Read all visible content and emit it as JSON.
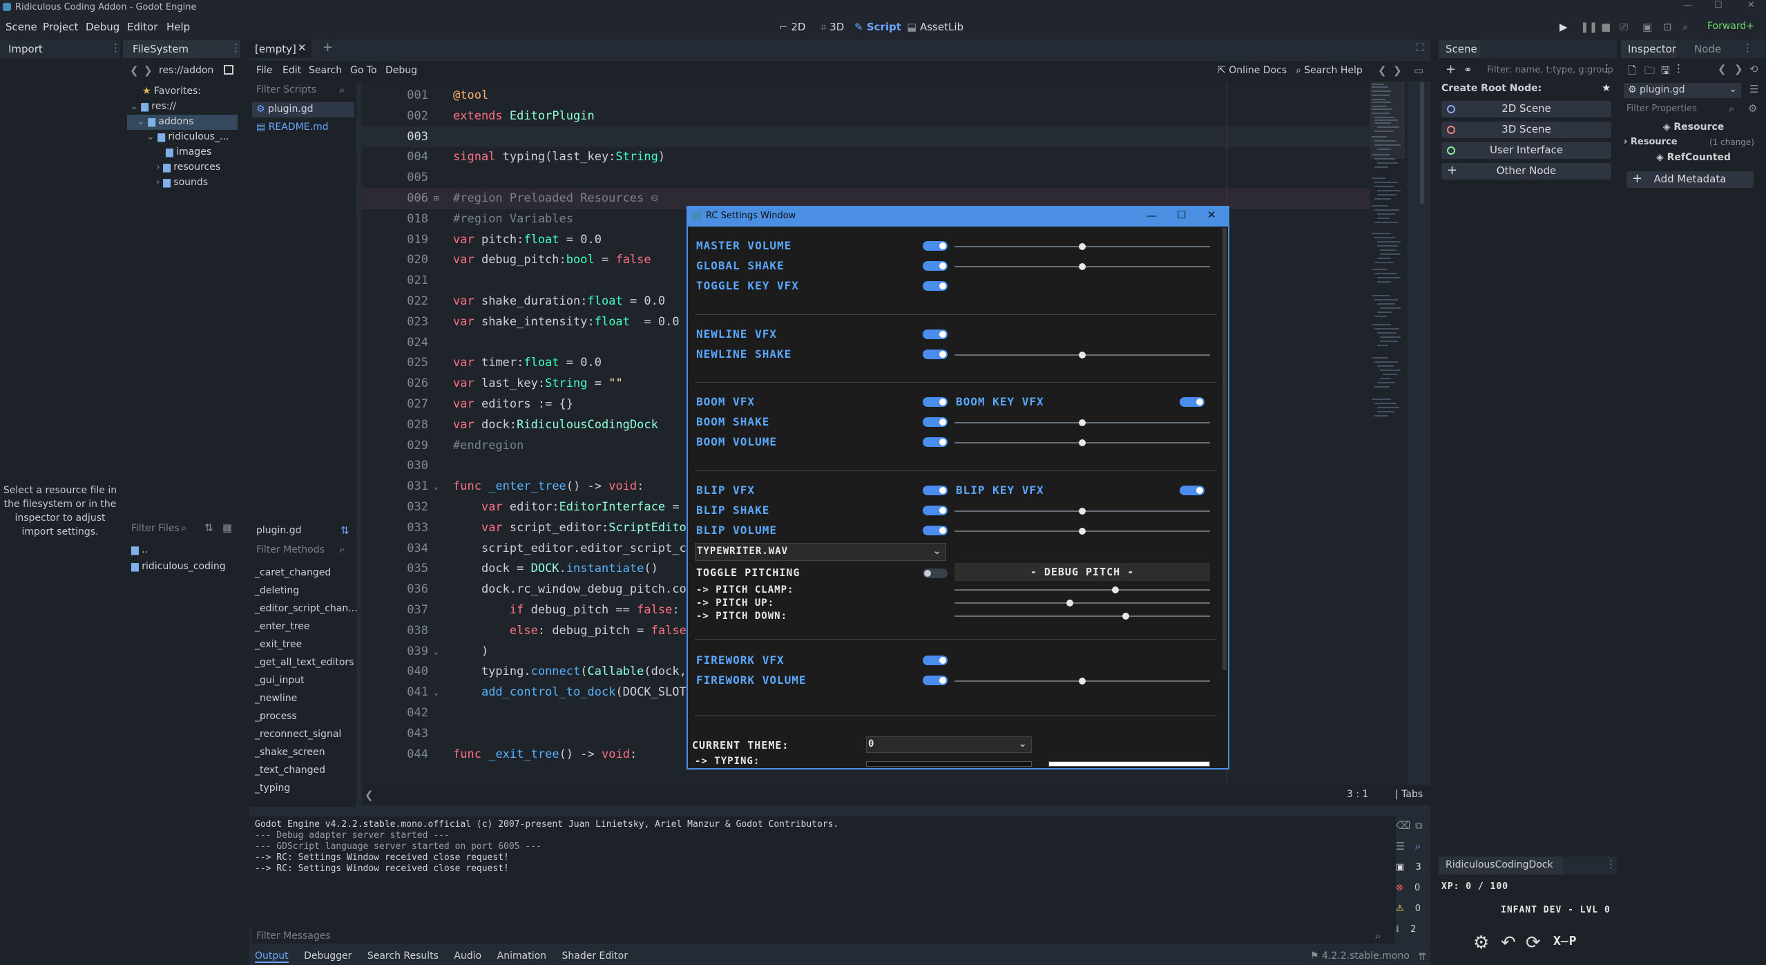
{
  "window": {
    "title": "Ridiculous Coding Addon - Godot Engine"
  },
  "menu": [
    "Scene",
    "Project",
    "Debug",
    "Editor",
    "Help"
  ],
  "workspaces": [
    {
      "label": "2D",
      "icon": "2d-icon"
    },
    {
      "label": "3D",
      "icon": "3d-icon"
    },
    {
      "label": "Script",
      "icon": "script-icon",
      "active": true
    },
    {
      "label": "AssetLib",
      "icon": "assetlib-icon"
    }
  ],
  "renderer": "Forward+",
  "import": {
    "tab": "Import",
    "hint": [
      "Select a resource file in",
      "the filesystem or in the",
      "inspector to adjust",
      "import settings."
    ]
  },
  "filesystem": {
    "tab": "FileSystem",
    "path": "res://addon",
    "favorites": "Favorites:",
    "tree": [
      {
        "label": "res://",
        "depth": 0
      },
      {
        "label": "addons",
        "depth": 1,
        "selected": true
      },
      {
        "label": "ridiculous_...",
        "depth": 2
      },
      {
        "label": "images",
        "depth": 3
      },
      {
        "label": "resources",
        "depth": 3
      },
      {
        "label": "sounds",
        "depth": 3
      }
    ],
    "filter_placeholder": "Filter Files",
    "files": [
      "..",
      "ridiculous_coding"
    ]
  },
  "script_tabs": {
    "active": "[empty]"
  },
  "script_menu": [
    "File",
    "Edit",
    "Search",
    "Go To",
    "Debug"
  ],
  "script_links": {
    "docs": "Online Docs",
    "help": "Search Help"
  },
  "scripts": {
    "filter_placeholder": "Filter Scripts",
    "items": [
      {
        "name": "plugin.gd",
        "active": true
      },
      {
        "name": "README.md",
        "active": false
      }
    ]
  },
  "methods": {
    "file": "plugin.gd",
    "filter_placeholder": "Filter Methods",
    "items": [
      "_caret_changed",
      "_deleting",
      "_editor_script_chan...",
      "_enter_tree",
      "_exit_tree",
      "_get_all_text_editors",
      "_gui_input",
      "_newline",
      "_process",
      "_reconnect_signal",
      "_shake_screen",
      "_text_changed",
      "_typing"
    ]
  },
  "code": {
    "lines": [
      {
        "n": "001",
        "h": "<span class='ann'>@tool</span>"
      },
      {
        "n": "002",
        "h": "<span class='kw'>extends</span> <span class='cls'>EditorPlugin</span>"
      },
      {
        "n": "003",
        "h": "",
        "cur": true
      },
      {
        "n": "004",
        "h": "<span class='kw'>signal</span> typing(last_key:<span class='ty'>String</span>)"
      },
      {
        "n": "005",
        "h": ""
      },
      {
        "n": "006",
        "h": "<span class='cm'>#region Preloaded Resources</span> <span class='cm'>⊝</span>",
        "fold": true
      },
      {
        "n": "018",
        "h": "<span class='cm'>#region Variables</span>"
      },
      {
        "n": "019",
        "h": "<span class='kw'>var</span> pitch:<span class='ty'>float</span> = 0.0"
      },
      {
        "n": "020",
        "h": "<span class='kw'>var</span> debug_pitch:<span class='ty'>bool</span> = <span class='kw'>false</span>"
      },
      {
        "n": "021",
        "h": ""
      },
      {
        "n": "022",
        "h": "<span class='kw'>var</span> shake_duration:<span class='ty'>float</span> = 0.0"
      },
      {
        "n": "023",
        "h": "<span class='kw'>var</span> shake_intensity:<span class='ty'>float</span>  = 0.0"
      },
      {
        "n": "024",
        "h": ""
      },
      {
        "n": "025",
        "h": "<span class='kw'>var</span> timer:<span class='ty'>float</span> = 0.0"
      },
      {
        "n": "026",
        "h": "<span class='kw'>var</span> last_key:<span class='ty'>String</span> = <span class='str'>\"\"</span>"
      },
      {
        "n": "027",
        "h": "<span class='kw'>var</span> editors := {}"
      },
      {
        "n": "028",
        "h": "<span class='kw'>var</span> dock:<span class='cls'>RidiculousCodingDock</span>"
      },
      {
        "n": "029",
        "h": "<span class='cm'>#endregion</span>"
      },
      {
        "n": "030",
        "h": ""
      },
      {
        "n": "031",
        "h": "<span class='kw'>func</span> <span class='fn'>_enter_tree</span>() -> <span class='kw'>void</span>:"
      },
      {
        "n": "032",
        "h": "    <span class='kw'>var</span> editor:<span class='cls'>EditorInterface</span> ="
      },
      {
        "n": "033",
        "h": "    <span class='kw'>var</span> script_editor:<span class='cls'>ScriptEdito</span>"
      },
      {
        "n": "034",
        "h": "    script_editor.editor_script_c"
      },
      {
        "n": "035",
        "h": "    dock = <span class='cls'>DOCK</span>.<span class='fn'>instantiate</span>()"
      },
      {
        "n": "036",
        "h": "    dock.rc_window_debug_pitch.co"
      },
      {
        "n": "037",
        "h": "        <span class='kw'>if</span> debug_pitch == <span class='kw'>false</span>:"
      },
      {
        "n": "038",
        "h": "        <span class='kw'>else</span>: debug_pitch = <span class='kw'>false</span>"
      },
      {
        "n": "039",
        "h": "    )"
      },
      {
        "n": "040",
        "h": "    typing.<span class='fn'>connect</span>(<span class='cls'>Callable</span>(dock,"
      },
      {
        "n": "041",
        "h": "    <span class='fn'>add_control_to_dock</span>(DOCK_SLOT"
      },
      {
        "n": "042",
        "h": ""
      },
      {
        "n": "043",
        "h": ""
      },
      {
        "n": "044",
        "h": "<span class='kw'>func</span> <span class='fn'>_exit_tree</span>() -> <span class='kw'>void</span>:"
      }
    ]
  },
  "status": {
    "pos": "3 :    1",
    "indent": "Tabs"
  },
  "output": {
    "lines": [
      "Godot Engine v4.2.2.stable.mono.official (c) 2007-present Juan Linietsky, Ariel Manzur & Godot Contributors.",
      "--- Debug adapter server started ---",
      "--- GDScript language server started on port 6005 ---",
      "--> RC: Settings Window received close request!",
      "--> RC: Settings Window received close request!"
    ],
    "filter_placeholder": "Filter Messages",
    "counts": [
      "3",
      "0",
      "0",
      "2"
    ]
  },
  "bottom_tabs": [
    "Output",
    "Debugger",
    "Search Results",
    "Audio",
    "Animation",
    "Shader Editor"
  ],
  "version": "4.2.2.stable.mono",
  "rc_window": {
    "title": "RC Settings Window",
    "rows": [
      {
        "label": "MASTER VOLUME",
        "on": true,
        "slider": 0.5
      },
      {
        "label": "GLOBAL SHAKE",
        "on": true,
        "slider": 0.5
      },
      {
        "label": "TOGGLE KEY VFX",
        "on": true
      },
      {
        "label": "NEWLINE VFX",
        "on": true
      },
      {
        "label": "NEWLINE SHAKE",
        "on": true,
        "slider": 0.5
      },
      {
        "label": "BOOM VFX",
        "on": true,
        "right_label": "BOOM KEY VFX",
        "right_on": true
      },
      {
        "label": "BOOM SHAKE",
        "on": true,
        "slider": 0.5
      },
      {
        "label": "BOOM VOLUME",
        "on": true,
        "slider": 0.5
      },
      {
        "label": "BLIP VFX",
        "on": true,
        "right_label": "BLIP KEY VFX",
        "right_on": true
      },
      {
        "label": "BLIP SHAKE",
        "on": true,
        "slider": 0.5
      },
      {
        "label": "BLIP VOLUME",
        "on": true,
        "slider": 0.5
      },
      {
        "label": "FIREWORK VFX",
        "on": true
      },
      {
        "label": "FIREWORK VOLUME",
        "on": true,
        "slider": 0.5
      }
    ],
    "sound_select": "TYPEWRITER.WAV",
    "pitch": {
      "label": "TOGGLE PITCHING",
      "on": false,
      "debug_button": "- DEBUG PITCH -",
      "clamp": "-> PITCH CLAMP:",
      "up": "-> PITCH UP:",
      "down": "-> PITCH DOWN:",
      "clamp_v": 0.63,
      "up_v": 0.45,
      "down_v": 0.67
    },
    "theme": {
      "label": "CURRENT THEME:",
      "value": "0",
      "typing": "-> TYPING:"
    }
  },
  "scene": {
    "tab": "Scene",
    "filter_placeholder": "Filter: name, t:type, g:group",
    "create": "Create Root Node:",
    "nodes": [
      {
        "label": "2D Scene",
        "color": "#8da5f3"
      },
      {
        "label": "3D Scene",
        "color": "#fc7f7f"
      },
      {
        "label": "User Interface",
        "color": "#8eef97"
      },
      {
        "label": "Other Node",
        "color": "#e0e0e0"
      }
    ]
  },
  "inspector": {
    "tab": "Inspector",
    "tab2": "Node",
    "file": "plugin.gd",
    "filter_placeholder": "Filter Properties",
    "resource": "Resource",
    "section": "Resource",
    "changes": "(1 change)",
    "refcounted": "RefCounted",
    "add_meta": "Add Metadata"
  },
  "rc_dock": {
    "tab": "RidiculousCodingDock",
    "xp": "XP: 0 / 100",
    "rank": "INFANT DEV - LVL 0"
  }
}
